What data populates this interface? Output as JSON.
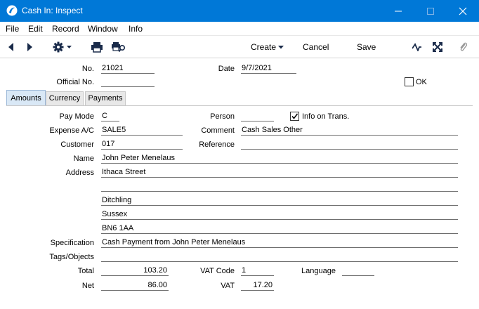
{
  "window": {
    "title": "Cash In: Inspect",
    "controls": [
      "minimize",
      "maximize",
      "close"
    ]
  },
  "menu": [
    "File",
    "Edit",
    "Record",
    "Window",
    "Info"
  ],
  "toolbar": {
    "create_label": "Create",
    "cancel_label": "Cancel",
    "save_label": "Save"
  },
  "header": {
    "no_label": "No.",
    "no_value": "21021",
    "date_label": "Date",
    "date_value": "9/7/2021",
    "official_label": "Official No.",
    "official_value": "",
    "ok_label": "OK",
    "ok_checked": false
  },
  "tabs": [
    "Amounts",
    "Currency",
    "Payments"
  ],
  "active_tab": "Amounts",
  "fields": {
    "pay_mode_label": "Pay Mode",
    "pay_mode": "C",
    "person_label": "Person",
    "person": "",
    "info_on_trans_label": "Info on Trans.",
    "info_on_trans_checked": true,
    "expense_label": "Expense A/C",
    "expense": "SALE5",
    "comment_label": "Comment",
    "comment": "Cash Sales Other",
    "customer_label": "Customer",
    "customer": "017",
    "reference_label": "Reference",
    "reference": "",
    "name_label": "Name",
    "name": "John Peter Menelaus",
    "address_label": "Address",
    "address": [
      "Ithaca Street",
      "",
      "Ditchling",
      "Sussex",
      "BN6 1AA"
    ],
    "specification_label": "Specification",
    "specification": "Cash Payment from John Peter Menelaus",
    "tags_label": "Tags/Objects",
    "tags": "",
    "total_label": "Total",
    "total": "103.20",
    "vat_code_label": "VAT Code",
    "vat_code": "1",
    "language_label": "Language",
    "language": "",
    "net_label": "Net",
    "net": "86.00",
    "vat_label": "VAT",
    "vat": "17.20"
  },
  "colors": {
    "titlebar": "#0078d7",
    "active_tab": "#d9e8f6"
  }
}
